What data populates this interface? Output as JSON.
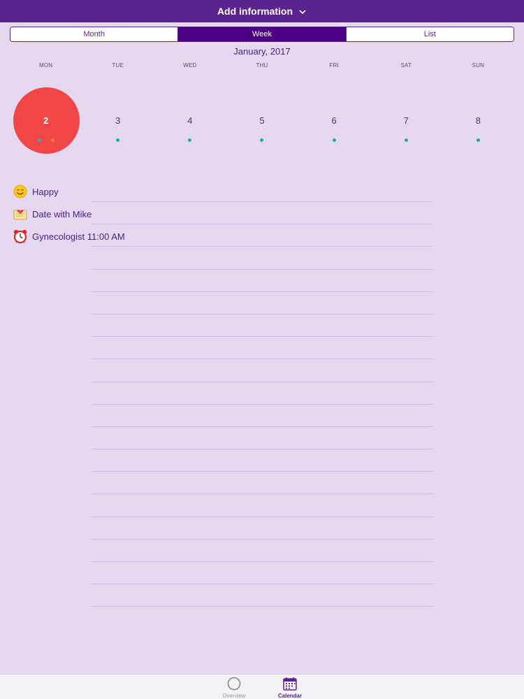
{
  "header": {
    "title": "Add information"
  },
  "view_switch": {
    "items": [
      {
        "label": "Month",
        "active": false
      },
      {
        "label": "Week",
        "active": true
      },
      {
        "label": "List",
        "active": false
      }
    ]
  },
  "calendar": {
    "month_title": "January, 2017",
    "weekdays": [
      "MON",
      "TUE",
      "WED",
      "THU",
      "FRI",
      "SAT",
      "SUN"
    ],
    "days": [
      {
        "number": "2",
        "selected": true,
        "dot_colors": [
          "#4A9FB5",
          "#F5822A"
        ]
      },
      {
        "number": "3",
        "selected": false,
        "dot_colors": [
          "#25A89A"
        ]
      },
      {
        "number": "4",
        "selected": false,
        "dot_colors": [
          "#25A89A"
        ]
      },
      {
        "number": "5",
        "selected": false,
        "dot_colors": [
          "#25A89A"
        ]
      },
      {
        "number": "6",
        "selected": false,
        "dot_colors": [
          "#25A89A"
        ]
      },
      {
        "number": "7",
        "selected": false,
        "dot_colors": [
          "#25A89A"
        ]
      },
      {
        "number": "8",
        "selected": false,
        "dot_colors": [
          "#25A89A"
        ]
      }
    ]
  },
  "events": [
    {
      "icon": "smiley-face-icon",
      "label": "Happy"
    },
    {
      "icon": "love-note-icon",
      "label": "Date with Mike"
    },
    {
      "icon": "alarm-clock-icon",
      "label": "Gynecologist 11:00 AM"
    }
  ],
  "tabbar": {
    "overview": {
      "label": "Overview",
      "icon": "circle-icon"
    },
    "calendar": {
      "label": "Calendar",
      "icon": "calendar-icon"
    }
  },
  "colors": {
    "header_bg": "#5B238F",
    "segment_active": "#4A0085",
    "background": "#E7D8F2",
    "selected_day": "#F04646",
    "dot_teal": "#25A89A"
  }
}
